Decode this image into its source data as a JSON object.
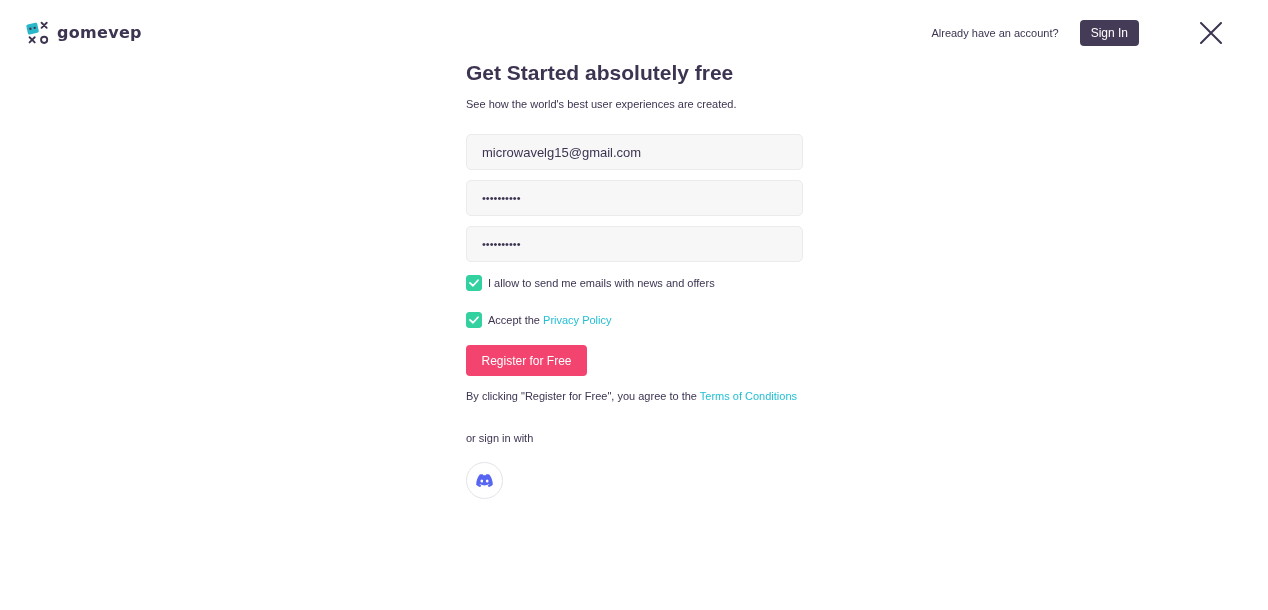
{
  "header": {
    "logo_text": "gomevep",
    "account_prompt": "Already have an account?",
    "sign_in_button": "Sign In"
  },
  "form": {
    "title": "Get Started absolutely free",
    "subtitle": "See how the world's best user experiences are created.",
    "fields": [
      {
        "kind": "email",
        "value": "microwavelg15@gmail.com"
      },
      {
        "kind": "password",
        "value": "••••••••••"
      },
      {
        "kind": "password",
        "value": "••••••••••"
      }
    ],
    "checkboxes": [
      {
        "text": "I allow to send me emails with news and offers",
        "checked": true
      },
      {
        "text": "Accept the",
        "link": "Privacy Policy",
        "checked": true
      }
    ],
    "submit_button": "Register for Free",
    "terms": {
      "text": "By clicking \"Register for Free\", you agree to the",
      "link": "Terms of Conditions"
    },
    "social_prompt": "or sign in with"
  }
}
